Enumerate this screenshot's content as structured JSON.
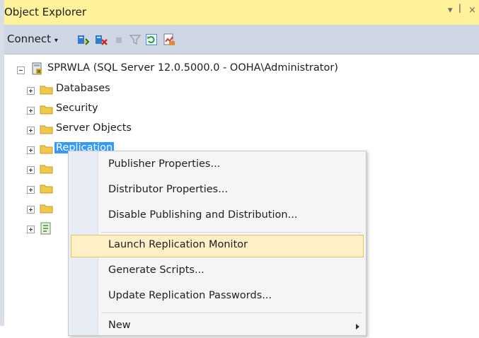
{
  "panel": {
    "title": "Object Explorer",
    "pin_glyph": "▾ ⊥ ×"
  },
  "toolbar": {
    "connect_label": "Connect",
    "icons": [
      "connect-object-explorer-icon",
      "disconnect-icon",
      "stop-icon",
      "filter-icon",
      "refresh-icon",
      "activity-monitor-icon"
    ]
  },
  "tree": {
    "server": "SPRWLA (SQL Server 12.0.5000.0 - OOHA\\Administrator)",
    "nodes": [
      "Databases",
      "Security",
      "Server Objects",
      "Replication"
    ]
  },
  "context_menu": {
    "items": [
      "Publisher Properties...",
      "Distributor Properties...",
      "Disable Publishing and Distribution...",
      "Launch Replication Monitor",
      "Generate Scripts...",
      "Update Replication Passwords...",
      "New"
    ],
    "highlighted": "Launch Replication Monitor"
  }
}
